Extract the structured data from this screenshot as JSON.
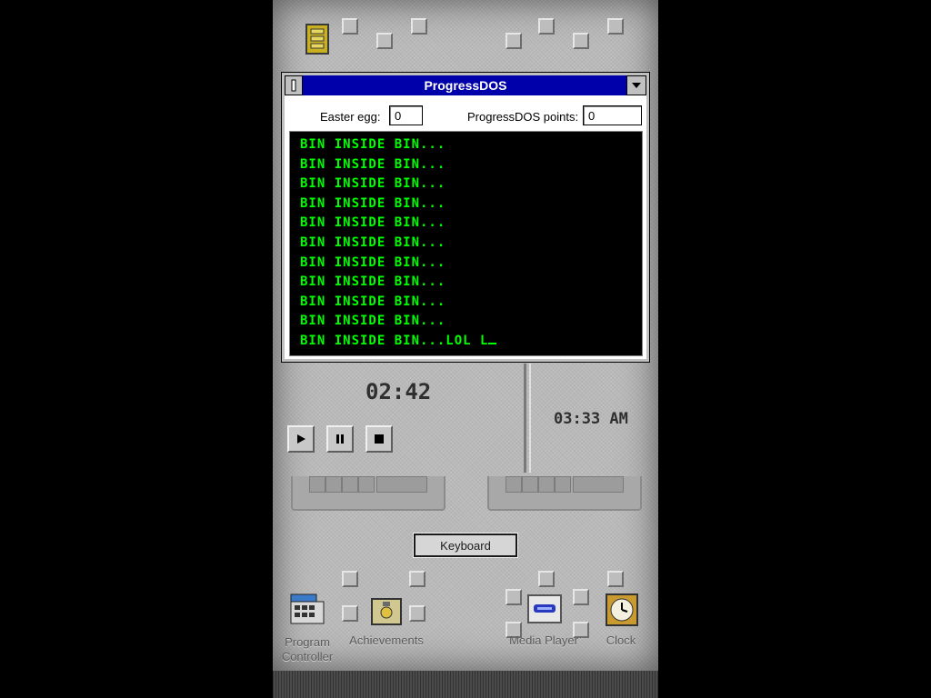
{
  "window": {
    "title": "ProgressDOS",
    "easter_egg_label": "Easter egg:",
    "easter_egg_value": "0",
    "points_label": "ProgressDOS points:",
    "points_value": "0",
    "console_lines": [
      "BIN INSIDE BIN...",
      "BIN INSIDE BIN...",
      "BIN INSIDE BIN...",
      "BIN INSIDE BIN...",
      "BIN INSIDE BIN...",
      "BIN INSIDE BIN...",
      "BIN INSIDE BIN...",
      "BIN INSIDE BIN...",
      "BIN INSIDE BIN...",
      "BIN INSIDE BIN...",
      "BIN INSIDE BIN...LOL L"
    ]
  },
  "media": {
    "elapsed": "02:42",
    "play_icon": "play-icon",
    "pause_icon": "pause-icon",
    "stop_icon": "stop-icon"
  },
  "clock": {
    "time": "03:33 AM"
  },
  "keyboard_button_label": "Keyboard",
  "desktop_icons": [
    {
      "label": "Program Controller",
      "icon": "program-controller-icon"
    },
    {
      "label": "Achievements",
      "icon": "achievements-icon"
    },
    {
      "label": "Media Player",
      "icon": "media-player-icon"
    },
    {
      "label": "Clock",
      "icon": "clock-icon"
    }
  ],
  "colors": {
    "titlebar": "#0000aa",
    "console_text": "#00ff00",
    "console_bg": "#000000"
  }
}
